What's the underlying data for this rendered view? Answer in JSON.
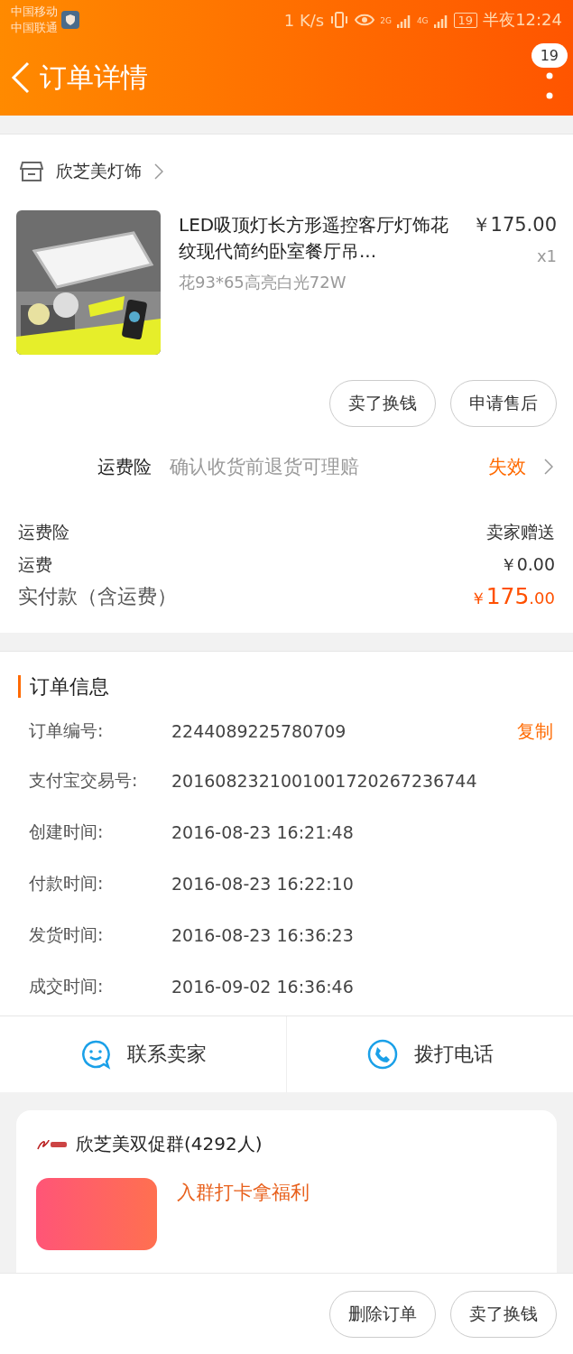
{
  "status_bar": {
    "carriers": [
      "中国移动",
      "中国联通"
    ],
    "speed": "1 K/s",
    "net_1": "2G",
    "net_2": "4G",
    "battery": "19",
    "time": "半夜12:24"
  },
  "header": {
    "title": "订单详情",
    "badge": "19"
  },
  "store": {
    "name": "欣芝美灯饰"
  },
  "item": {
    "kind": "picture",
    "title": "LED吸顶灯长方形遥控客厅灯饰花纹现代简约卧室餐厅吊...",
    "variant": "花93*65高亮白光72W",
    "price": "￥175.00",
    "quantity": "x1"
  },
  "item_buttons": [
    "卖了换钱",
    "申请售后"
  ],
  "insurance": {
    "label": "运费险",
    "description": "确认收货前退货可理赔",
    "status": "失效"
  },
  "summary": [
    {
      "label": "运费险",
      "value": "卖家赠送"
    },
    {
      "label": "运费",
      "value": "￥0.00"
    }
  ],
  "total": {
    "label": "实付款（含运费）",
    "currency": "￥",
    "integer": "175",
    "decimals": ".00"
  },
  "order_info": {
    "title": "订单信息",
    "copy": "复制",
    "rows": [
      {
        "label": "订单编号:",
        "value": "2244089225780709"
      },
      {
        "label": "支付宝交易号:",
        "value": "2016082321001001720267236744"
      },
      {
        "label": "创建时间:",
        "value": "2016-08-23 16:21:48"
      },
      {
        "label": "付款时间:",
        "value": "2016-08-23 16:22:10"
      },
      {
        "label": "发货时间:",
        "value": "2016-08-23 16:36:23"
      },
      {
        "label": "成交时间:",
        "value": "2016-09-02 16:36:46"
      }
    ]
  },
  "contact": [
    {
      "kind": "chat",
      "label": "联系卖家"
    },
    {
      "kind": "phone",
      "label": "拨打电话"
    }
  ],
  "group": {
    "name": "欣芝美双促群(4292人)",
    "promo": "入群打卡拿福利"
  },
  "bottom_buttons": [
    "删除订单",
    "卖了换钱"
  ]
}
